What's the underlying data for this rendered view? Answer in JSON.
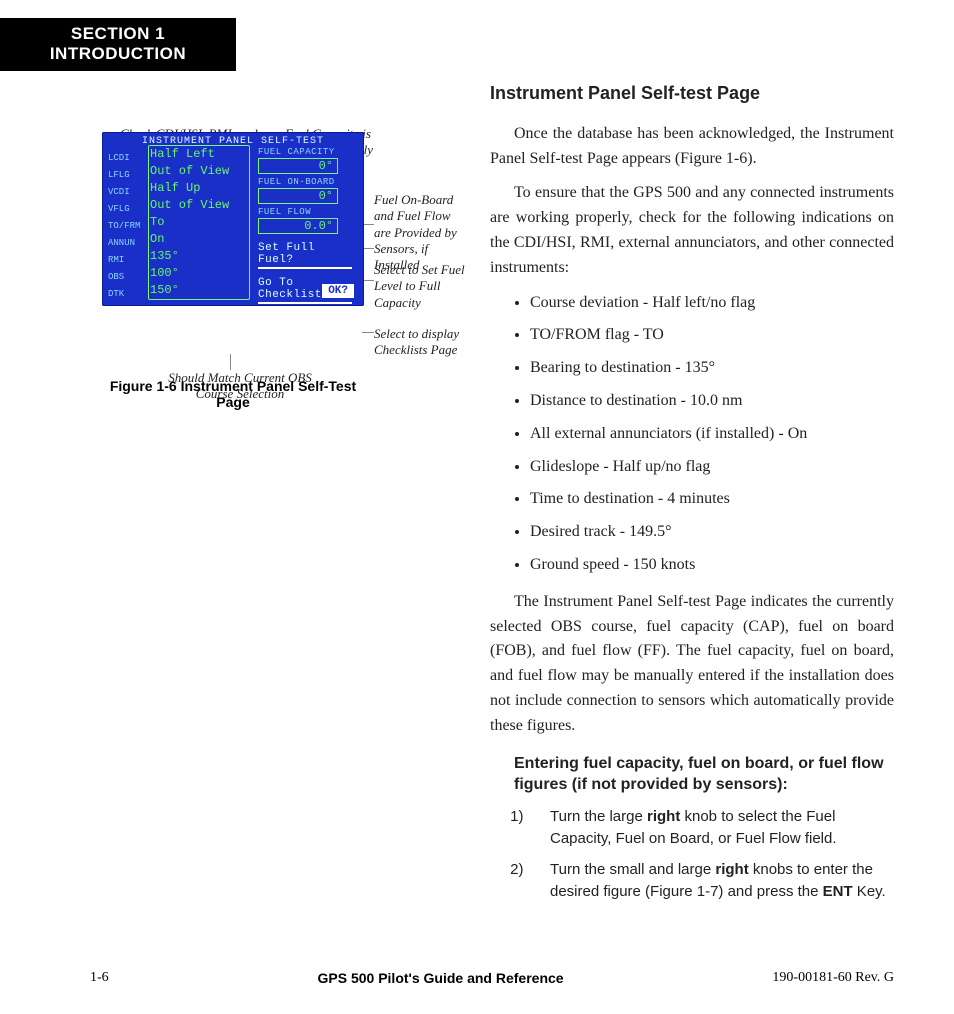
{
  "header": {
    "line1": "SECTION 1",
    "line2": "INTRODUCTION"
  },
  "figure": {
    "annotations": {
      "top1": "Check CDI/HSI, RMI, and Other Instruments to verify these Indications",
      "top2": "Fuel Capacity is entered manually",
      "r1": "Fuel On-Board and Fuel Flow are Provided by Sensors, if Installed",
      "r2": "Select to Set Fuel Level to Full Capacity",
      "r3": "Select to display Checklists Page",
      "bottom": "Should Match Current OBS Course Selection"
    },
    "screen": {
      "title": "INSTRUMENT PANEL SELF-TEST",
      "left_labels": [
        "LCDI",
        "LFLG",
        "VCDI",
        "VFLG",
        "TO/FRM",
        "ANNUN",
        "RMI",
        "OBS",
        "DTK"
      ],
      "values": [
        "Half Left",
        "Out of View",
        "Half Up",
        "Out of View",
        "To",
        "On",
        "135°",
        "100°",
        "150°"
      ],
      "fuel": {
        "cap_label": "FUEL CAPACITY",
        "cap_value": "0°",
        "fob_label": "FUEL ON-BOARD",
        "fob_value": "0°",
        "ff_label": "FUEL FLOW",
        "ff_value": "0.0°"
      },
      "set_full": "Set Full Fuel?",
      "checklists": "Go To Checklists?",
      "ok": "OK?"
    },
    "caption": "Figure 1-6  Instrument Panel Self-Test Page"
  },
  "body": {
    "heading": "Instrument Panel Self-test Page",
    "p1": "Once the database has been acknowledged, the Instrument Panel Self-test Page appears (Figure 1-6).",
    "p2": "To ensure that the GPS 500 and any connected instruments are working properly, check for the following indications on the CDI/HSI, RMI, external annunciators, and other connected instruments:",
    "bullets": [
      "Course deviation - Half left/no flag",
      "TO/FROM flag - TO",
      "Bearing to destination - 135°",
      "Distance to destination - 10.0 nm",
      "All external annunciators (if installed) - On",
      "Glideslope - Half up/no flag",
      "Time to destination - 4 minutes",
      "Desired track - 149.5°",
      "Ground speed - 150 knots"
    ],
    "p3": "The Instrument Panel Self-test Page indicates the currently selected OBS course, fuel capacity (CAP), fuel on board (FOB), and fuel flow (FF).  The fuel capacity, fuel on board, and fuel flow may be manually entered if the installation does not include connection to sensors which automatically provide these figures.",
    "subhead": "Entering fuel capacity, fuel on board, or fuel flow figures (if not provided by sensors):",
    "steps": [
      {
        "pre": "Turn the large ",
        "b": "right",
        "post": " knob to select the Fuel Capacity, Fuel on Board, or Fuel Flow field."
      },
      {
        "pre": "Turn the small and large ",
        "b": "right",
        "post": " knobs to enter the desired figure (Figure 1-7) and press the ",
        "b2": "ENT",
        "post2": " Key."
      }
    ]
  },
  "footer": {
    "left": "1-6",
    "center": "GPS 500 Pilot's Guide and Reference",
    "right": "190-00181-60  Rev. G"
  }
}
